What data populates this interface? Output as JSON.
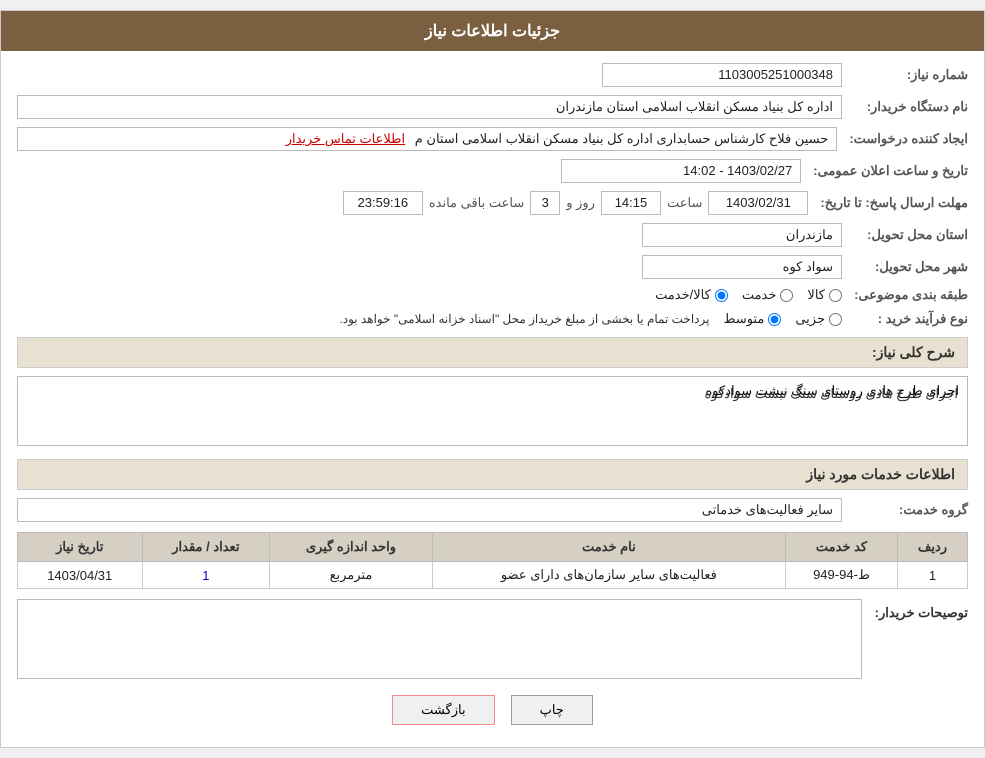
{
  "header": {
    "title": "جزئیات اطلاعات نیاز"
  },
  "fields": {
    "needNumber_label": "شماره نیاز:",
    "needNumber_value": "1103005251000348",
    "buyerOrg_label": "نام دستگاه خریدار:",
    "buyerOrg_value": "اداره کل بنیاد مسکن انقلاب اسلامی استان مازندران",
    "requestCreator_label": "ایجاد کننده درخواست:",
    "requestCreator_value": "حسین فلاح کارشناس حسابداری اداره کل بنیاد مسکن انقلاب اسلامی استان م",
    "requestCreator_link": "اطلاعات تماس خریدار",
    "announceDate_label": "تاریخ و ساعت اعلان عمومی:",
    "announceDate_value": "1403/02/27 - 14:02",
    "replyDeadline_label": "مهلت ارسال پاسخ: تا تاریخ:",
    "replyDate_value": "1403/02/31",
    "replyTime_label": "ساعت",
    "replyTime_value": "14:15",
    "replyDays_label": "روز و",
    "replyDays_value": "3",
    "remainingTime_label": "ساعت باقی مانده",
    "remainingTime_value": "23:59:16",
    "province_label": "استان محل تحویل:",
    "province_value": "مازندران",
    "city_label": "شهر محل تحویل:",
    "city_value": "سواد کوه",
    "category_label": "طبقه بندی موضوعی:",
    "category_options": [
      "کالا",
      "خدمت",
      "کالا/خدمت"
    ],
    "category_selected": "کالا/خدمت",
    "processType_label": "نوع فرآیند خرید :",
    "processType_options": [
      "جزیی",
      "متوسط"
    ],
    "processType_note": "پرداخت تمام یا بخشی از مبلغ خریداز محل \"اسناد خزانه اسلامی\" خواهد بود.",
    "description_label": "شرح کلی نیاز:",
    "description_value": "اجرای طرح هادی روستای سنگ نبشت سوادکوه"
  },
  "servicesSection": {
    "title": "اطلاعات خدمات مورد نیاز",
    "serviceGroup_label": "گروه خدمت:",
    "serviceGroup_value": "سایر فعالیت‌های خدماتی",
    "table": {
      "columns": [
        "ردیف",
        "کد خدمت",
        "نام خدمت",
        "واحد اندازه گیری",
        "تعداد / مقدار",
        "تاریخ نیاز"
      ],
      "rows": [
        {
          "row": "1",
          "code": "ط-94-949",
          "name": "فعالیت‌های سایر سازمان‌های دارای عضو",
          "unit": "مترمربع",
          "quantity": "1",
          "date": "1403/04/31"
        }
      ]
    }
  },
  "buyerDesc": {
    "label": "توصیحات خریدار:",
    "value": ""
  },
  "buttons": {
    "print": "چاپ",
    "back": "بازگشت"
  }
}
